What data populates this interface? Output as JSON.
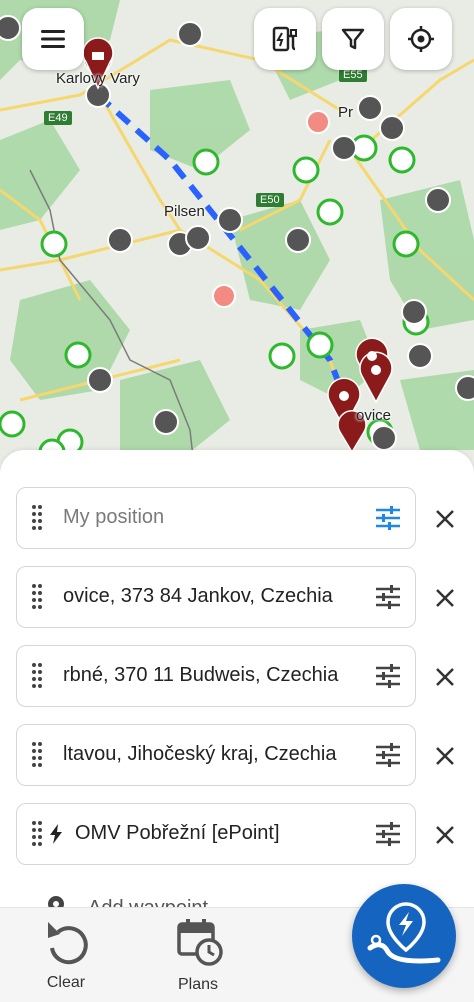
{
  "map": {
    "cities": {
      "karlovy_vary": "Karlovy Vary",
      "pilsen": "Pilsen",
      "prague": "Pr",
      "budweis": "ovice"
    },
    "roads": {
      "e49": "E49",
      "e55": "E55",
      "e50": "E50"
    }
  },
  "waypoints": [
    {
      "text": "My position",
      "placeholder": true
    },
    {
      "text": "ovice, 373 84 Jankov, Czechia",
      "placeholder": false
    },
    {
      "text": "rbné, 370 11 Budweis, Czechia",
      "placeholder": false
    },
    {
      "text": "ltavou, Jihočeský kraj, Czechia",
      "placeholder": false
    },
    {
      "text": "OMV Pobřežní [ePoint]",
      "placeholder": false
    }
  ],
  "add_waypoint_label": "Add waypoint",
  "nav": {
    "clear_label": "Clear",
    "plans_label": "Plans"
  },
  "colors": {
    "accent": "#1565c0",
    "charger_green": "#2eb82e",
    "charger_gray": "#555555",
    "marker_red": "#8b1a1a",
    "route_blue": "#2962ff"
  }
}
